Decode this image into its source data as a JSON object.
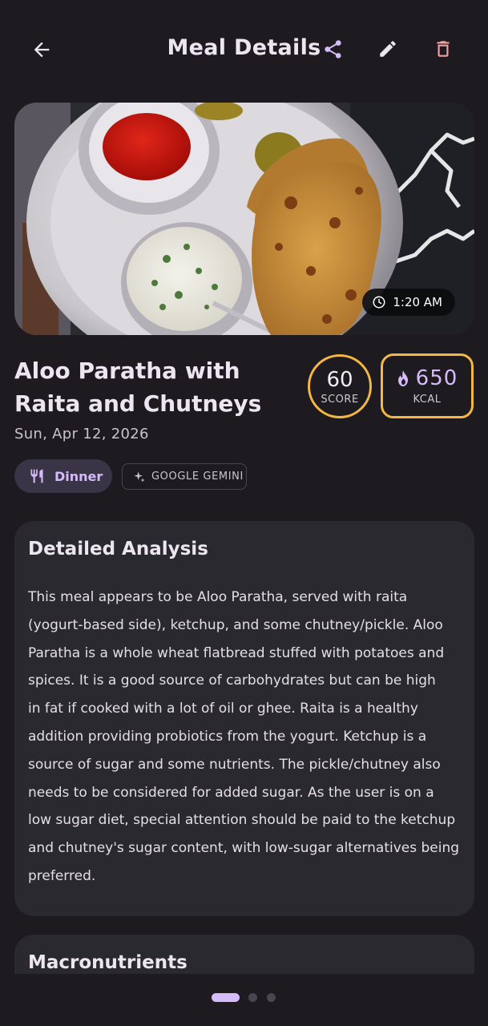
{
  "app_bar": {
    "title": "Meal Details",
    "back_icon": "arrow-left-icon",
    "share_icon": "share-icon",
    "edit_icon": "pencil-icon",
    "delete_icon": "trash-icon"
  },
  "hero": {
    "time": "1:20 AM",
    "time_icon": "clock-icon"
  },
  "meal": {
    "name": "Aloo Paratha with Raita and Chutneys",
    "date": "Sun, Apr 12, 2026",
    "score_value": "60",
    "score_label": "SCORE",
    "kcal_value": "650",
    "kcal_label": "KCAL",
    "kcal_icon": "flame-icon"
  },
  "chips": {
    "meal_type": "Dinner",
    "meal_type_icon": "utensils-icon",
    "source": "GOOGLE GEMINI",
    "source_icon": "sparkle-icon"
  },
  "analysis": {
    "title": "Detailed Analysis",
    "lines": [
      "This meal appears to be Aloo Paratha, served with raita",
      "(yogurt-based side), ketchup, and some chutney/pickle. Aloo",
      "Paratha is a whole wheat flatbread stuffed with potatoes and",
      "spices. It is a good source of carbohydrates but can be high",
      "in fat if cooked with a lot of oil or ghee. Raita is a healthy",
      "addition providing probiotics from the yogurt. Ketchup is a",
      "source of sugar and some nutrients. The pickle/chutney also",
      "needs to be considered for added sugar. As the user is on a",
      "low sugar diet, special attention should be paid to the ketchup",
      "and chutney's sugar content, with low-sugar alternatives being",
      "preferred."
    ]
  },
  "macros": {
    "title": "Macronutrients"
  },
  "pager": {
    "page_count": 3,
    "active_index": 0
  },
  "colors": {
    "background": "#1d1b20",
    "card": "#2b2930",
    "accent": "#d6bbfb",
    "ring": "#f4b740",
    "delete": "#f2a0a0"
  }
}
